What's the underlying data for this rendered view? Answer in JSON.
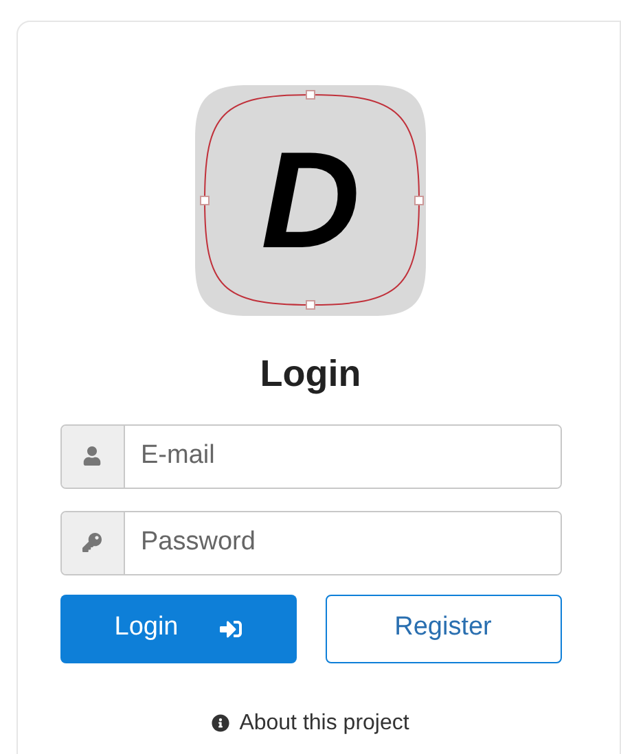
{
  "logo": {
    "letter": "D"
  },
  "title": "Login",
  "fields": [
    {
      "kind": "email",
      "placeholder": "E-mail"
    },
    {
      "kind": "password",
      "placeholder": "Password"
    }
  ],
  "buttons": [
    {
      "kind": "primary",
      "label": "Login"
    },
    {
      "kind": "secondary",
      "label": "Register"
    }
  ],
  "about_link": "About this project"
}
